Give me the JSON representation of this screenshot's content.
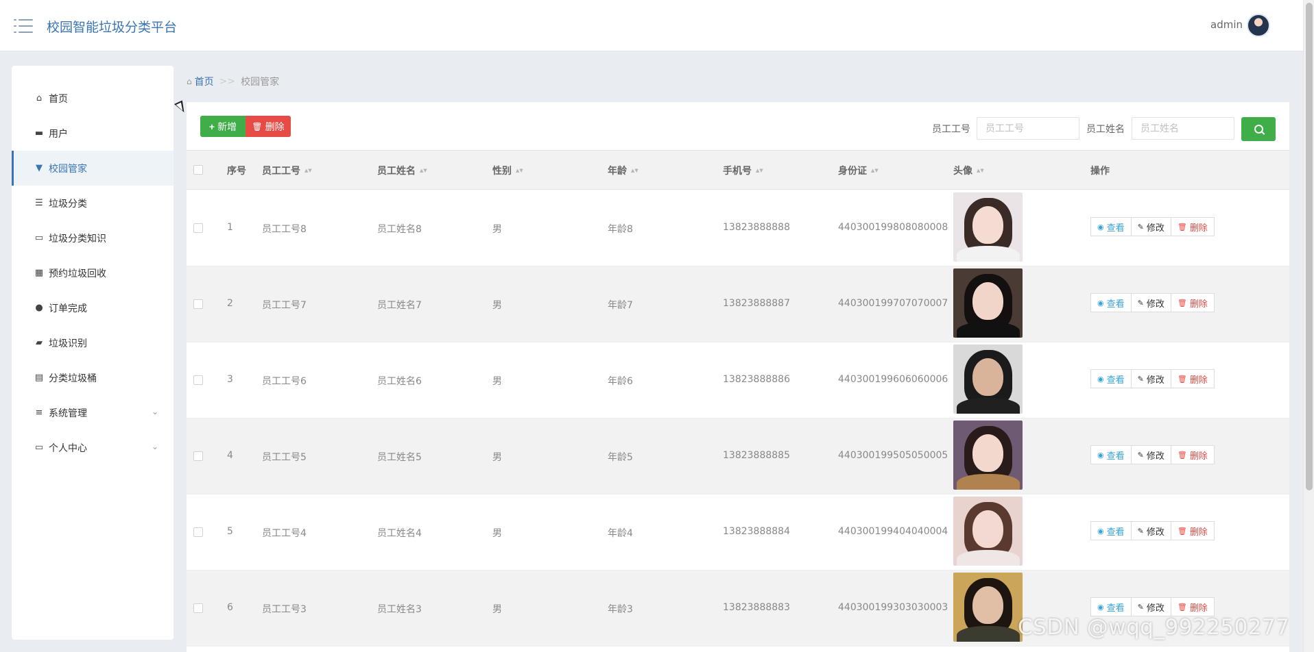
{
  "header": {
    "app_title": "校园智能垃圾分类平台",
    "user_name": "admin",
    "menu_icon": "hamburger-icon",
    "avatar_icon": "user-avatar"
  },
  "sidebar": {
    "items": [
      {
        "label": "首页",
        "icon": "home-icon",
        "active": false,
        "expandable": false
      },
      {
        "label": "用户",
        "icon": "chat-icon",
        "active": false,
        "expandable": false
      },
      {
        "label": "校园管家",
        "icon": "brush-icon",
        "active": true,
        "expandable": false
      },
      {
        "label": "垃圾分类",
        "icon": "list-icon",
        "active": false,
        "expandable": false
      },
      {
        "label": "垃圾分类知识",
        "icon": "monitor-icon",
        "active": false,
        "expandable": false
      },
      {
        "label": "预约垃圾回收",
        "icon": "grid-icon",
        "active": false,
        "expandable": false
      },
      {
        "label": "订单完成",
        "icon": "person-icon",
        "active": false,
        "expandable": false
      },
      {
        "label": "垃圾识别",
        "icon": "ticket-icon",
        "active": false,
        "expandable": false
      },
      {
        "label": "分类垃圾桶",
        "icon": "clipboard-icon",
        "active": false,
        "expandable": false
      },
      {
        "label": "系统管理",
        "icon": "sliders-icon",
        "active": false,
        "expandable": true
      },
      {
        "label": "个人中心",
        "icon": "card-icon",
        "active": false,
        "expandable": true
      }
    ]
  },
  "breadcrumb": {
    "home": "首页",
    "separator": ">>",
    "current": "校园管家"
  },
  "toolbar": {
    "add_label": "新增",
    "delete_label": "删除",
    "filter_id_label": "员工工号",
    "filter_id_placeholder": "员工工号",
    "filter_name_label": "员工姓名",
    "filter_name_placeholder": "员工姓名",
    "search_icon": "search-icon"
  },
  "table": {
    "columns": [
      "序号",
      "员工工号",
      "员工姓名",
      "性别",
      "年龄",
      "手机号",
      "身份证",
      "头像",
      "操作"
    ],
    "rows": [
      {
        "index": "1",
        "emp_id": "员工工号8",
        "name": "员工姓名8",
        "gender": "男",
        "age": "年龄8",
        "phone": "13823888888",
        "id_card": "440300199808080008"
      },
      {
        "index": "2",
        "emp_id": "员工工号7",
        "name": "员工姓名7",
        "gender": "男",
        "age": "年龄7",
        "phone": "13823888887",
        "id_card": "440300199707070007"
      },
      {
        "index": "3",
        "emp_id": "员工工号6",
        "name": "员工姓名6",
        "gender": "男",
        "age": "年龄6",
        "phone": "13823888886",
        "id_card": "440300199606060006"
      },
      {
        "index": "4",
        "emp_id": "员工工号5",
        "name": "员工姓名5",
        "gender": "男",
        "age": "年龄5",
        "phone": "13823888885",
        "id_card": "440300199505050005"
      },
      {
        "index": "5",
        "emp_id": "员工工号4",
        "name": "员工姓名4",
        "gender": "男",
        "age": "年龄4",
        "phone": "13823888884",
        "id_card": "440300199404040004"
      },
      {
        "index": "6",
        "emp_id": "员工工号3",
        "name": "员工姓名3",
        "gender": "男",
        "age": "年龄3",
        "phone": "13823888883",
        "id_card": "440300199303030003"
      }
    ],
    "actions": {
      "view": "查看",
      "edit": "修改",
      "delete": "删除"
    }
  },
  "watermark": "CSDN @wqq_992250277",
  "colors": {
    "primary": "#3a74b5",
    "success": "#3fae49",
    "danger": "#e64c45",
    "view": "#35a2d8"
  }
}
